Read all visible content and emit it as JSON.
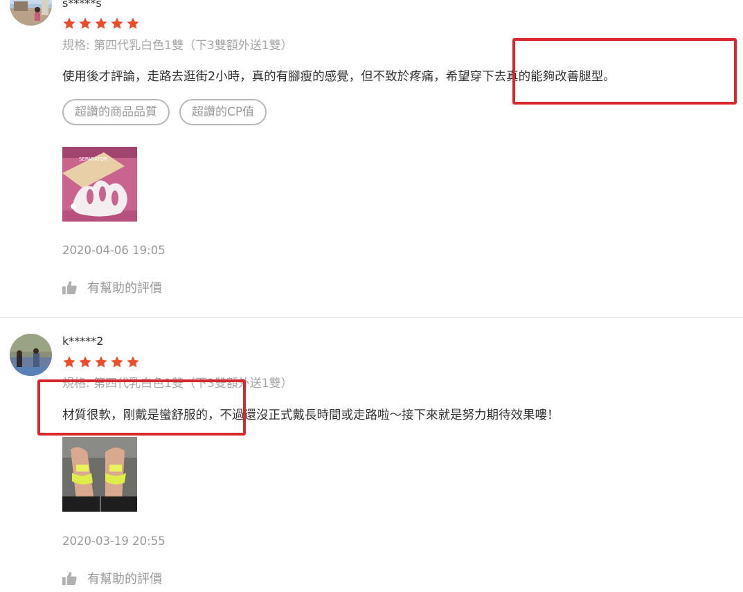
{
  "reviews": [
    {
      "username": "s*****s",
      "rating": 5,
      "spec": "規格: 第四代乳白色1雙（下3雙額外送1雙）",
      "body_part1": "使用後才評論，走路去逛街2小時，真的有腳瘦的感覺，但不致於疼痛，",
      "body_part2": "希望穿下去真的能夠改善腿型。",
      "tags": [
        "超讚的商品品質",
        "超讚的CP值"
      ],
      "photo_caption": "SEPARATOR",
      "date": "2020-04-06 19:05",
      "helpful_label": "有幫助的評價"
    },
    {
      "username": "k*****2",
      "rating": 5,
      "spec": "規格: 第四代乳白色1雙（下3雙額外送1雙）",
      "body_part1": "材質很軟，剛戴是蠻舒服的，",
      "body_part2": "不過還沒正式戴長時間或走路啦～接下來就是努力期待效果嘍！",
      "date": "2020-03-19 20:55",
      "helpful_label": "有幫助的評價"
    }
  ],
  "colors": {
    "star": "#ee4d2d",
    "highlight": "#d9282b",
    "muted_text": "#999999",
    "body_text": "#333333"
  },
  "icons": {
    "rating": "star-icon",
    "helpful": "thumbs-up-icon"
  }
}
